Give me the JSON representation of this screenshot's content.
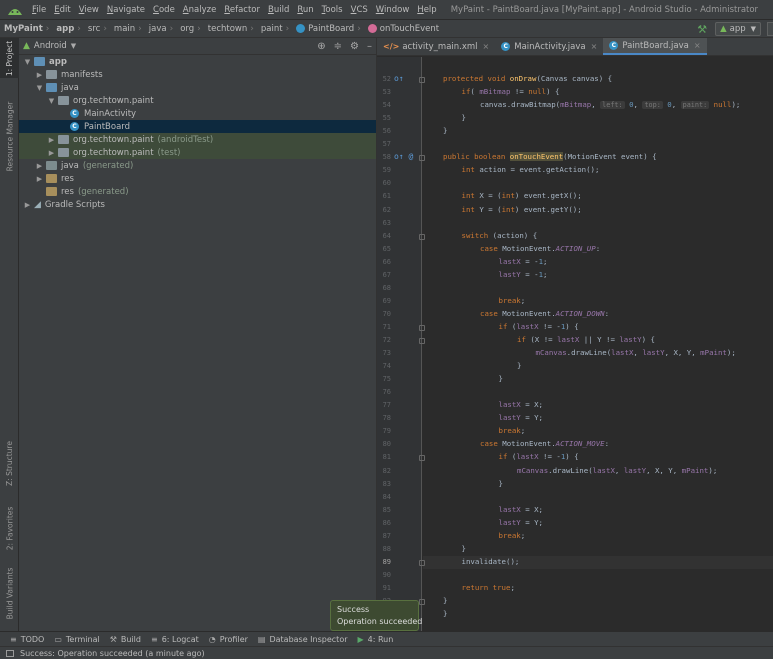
{
  "menubar": {
    "items": [
      "File",
      "Edit",
      "View",
      "Navigate",
      "Code",
      "Analyze",
      "Refactor",
      "Build",
      "Run",
      "Tools",
      "VCS",
      "Window",
      "Help"
    ],
    "window_title": "MyPaint - PaintBoard.java [MyPaint.app] - Android Studio - Administrator"
  },
  "navbar": {
    "crumbs": [
      "MyPaint",
      "app",
      "src",
      "main",
      "java",
      "org",
      "techtown",
      "paint",
      "PaintBoard",
      "onTouchEvent"
    ],
    "run_config": "app"
  },
  "left_strip": {
    "tabs": [
      "1: Project",
      "Resource Manager",
      "Z: Structure",
      "2: Favorites",
      "Build Variants"
    ]
  },
  "project": {
    "view_mode": "Android",
    "tree": [
      {
        "label": "app",
        "level": 0,
        "arrow": "open",
        "icon": "module"
      },
      {
        "label": "manifests",
        "level": 1,
        "arrow": "closed",
        "icon": "folder"
      },
      {
        "label": "java",
        "level": 1,
        "arrow": "open",
        "icon": "folder-blue"
      },
      {
        "label": "org.techtown.paint",
        "level": 2,
        "arrow": "open",
        "icon": "package"
      },
      {
        "label": "MainActivity",
        "level": 3,
        "arrow": "",
        "icon": "class"
      },
      {
        "label": "PaintBoard",
        "level": 3,
        "arrow": "",
        "icon": "class",
        "selected": true
      },
      {
        "label": "org.techtown.paint",
        "suffix": "(androidTest)",
        "level": 2,
        "arrow": "closed",
        "icon": "package",
        "tested": true
      },
      {
        "label": "org.techtown.paint",
        "suffix": "(test)",
        "level": 2,
        "arrow": "closed",
        "icon": "package",
        "tested": true
      },
      {
        "label": "java",
        "suffix": "(generated)",
        "level": 1,
        "arrow": "closed",
        "icon": "folder-gen"
      },
      {
        "label": "res",
        "level": 1,
        "arrow": "closed",
        "icon": "folder-res"
      },
      {
        "label": "res",
        "suffix": "(generated)",
        "level": 1,
        "arrow": "",
        "icon": "folder-res"
      },
      {
        "label": "Gradle Scripts",
        "level": 0,
        "arrow": "closed",
        "icon": "gradle"
      }
    ]
  },
  "editor": {
    "tabs": [
      {
        "label": "activity_main.xml",
        "icon": "xml",
        "active": false
      },
      {
        "label": "MainActivity.java",
        "icon": "class",
        "active": false
      },
      {
        "label": "PaintBoard.java",
        "icon": "class",
        "active": true
      }
    ],
    "lines": [
      {
        "n": "52",
        "html": "<span class=\"kw\">protected void </span><span class=\"fn\">onDraw</span>(Canvas canvas) {",
        "indent": 1,
        "mark": "override"
      },
      {
        "n": "53",
        "html": "<span class=\"kw\">if</span>( <span class=\"fld\">mBitmap</span> != <span class=\"kw\">null</span>) {",
        "indent": 2
      },
      {
        "n": "54",
        "html": "canvas.drawBitmap(<span class=\"fld\">mBitmap</span>, <span class=\"hint\">left:</span> <span class=\"num\">0</span>, <span class=\"hint\">top:</span> <span class=\"num\">0</span>, <span class=\"hint\">paint:</span> <span class=\"kw\">null</span>);",
        "indent": 3
      },
      {
        "n": "55",
        "html": "}",
        "indent": 2
      },
      {
        "n": "56",
        "html": "}",
        "indent": 1
      },
      {
        "n": "57",
        "html": "",
        "indent": 0
      },
      {
        "n": "58",
        "html": "<span class=\"kw\">public boolean </span><span class=\"fn hl\">onTouchEvent</span>(MotionEvent event) {",
        "indent": 1,
        "mark": "override-at"
      },
      {
        "n": "59",
        "html": "<span class=\"kw\">int </span>action = event.getAction();",
        "indent": 2
      },
      {
        "n": "60",
        "html": "",
        "indent": 0
      },
      {
        "n": "61",
        "html": "<span class=\"kw\">int </span>X = (<span class=\"kw\">int</span>) event.getX();",
        "indent": 2
      },
      {
        "n": "62",
        "html": "<span class=\"kw\">int </span>Y = (<span class=\"kw\">int</span>) event.getY();",
        "indent": 2
      },
      {
        "n": "63",
        "html": "",
        "indent": 0
      },
      {
        "n": "64",
        "html": "<span class=\"kw\">switch </span>(action) {",
        "indent": 2
      },
      {
        "n": "65",
        "html": "<span class=\"kw\">case </span>MotionEvent.<span class=\"st\">ACTION_UP</span>:",
        "indent": 3
      },
      {
        "n": "66",
        "html": "<span class=\"fld\">lastX</span> = -<span class=\"num\">1</span>;",
        "indent": 4
      },
      {
        "n": "67",
        "html": "<span class=\"fld\">lastY</span> = -<span class=\"num\">1</span>;",
        "indent": 4
      },
      {
        "n": "68",
        "html": "",
        "indent": 0
      },
      {
        "n": "69",
        "html": "<span class=\"kw\">break</span>;",
        "indent": 4
      },
      {
        "n": "70",
        "html": "<span class=\"kw\">case </span>MotionEvent.<span class=\"st\">ACTION_DOWN</span>:",
        "indent": 3
      },
      {
        "n": "71",
        "html": "<span class=\"kw\">if </span>(<span class=\"fld\">lastX</span> != -<span class=\"num\">1</span>) {",
        "indent": 4
      },
      {
        "n": "72",
        "html": "<span class=\"kw\">if </span>(X != <span class=\"fld\">lastX</span> || Y != <span class=\"fld\">lastY</span>) {",
        "indent": 5
      },
      {
        "n": "73",
        "html": "<span class=\"fld\">mCanvas</span>.drawLine(<span class=\"fld\">lastX</span>, <span class=\"fld\">lastY</span>, X, Y, <span class=\"fld\">mPaint</span>);",
        "indent": 6
      },
      {
        "n": "74",
        "html": "}",
        "indent": 5
      },
      {
        "n": "75",
        "html": "}",
        "indent": 4
      },
      {
        "n": "76",
        "html": "",
        "indent": 0
      },
      {
        "n": "77",
        "html": "<span class=\"fld\">lastX</span> = X;",
        "indent": 4
      },
      {
        "n": "78",
        "html": "<span class=\"fld\">lastY</span> = Y;",
        "indent": 4
      },
      {
        "n": "79",
        "html": "<span class=\"kw\">break</span>;",
        "indent": 4
      },
      {
        "n": "80",
        "html": "<span class=\"kw\">case </span>MotionEvent.<span class=\"st\">ACTION_MOVE</span>:",
        "indent": 3
      },
      {
        "n": "81",
        "html": "<span class=\"kw\">if </span>(<span class=\"fld\">lastX</span> != -<span class=\"num\">1</span>) {",
        "indent": 4
      },
      {
        "n": "82",
        "html": "<span class=\"fld\">mCanvas</span>.drawLine(<span class=\"fld\">lastX</span>, <span class=\"fld\">lastY</span>, X, Y, <span class=\"fld\">mPaint</span>);",
        "indent": 5
      },
      {
        "n": "83",
        "html": "}",
        "indent": 4
      },
      {
        "n": "84",
        "html": "",
        "indent": 0
      },
      {
        "n": "85",
        "html": "<span class=\"fld\">lastX</span> = X;",
        "indent": 4
      },
      {
        "n": "86",
        "html": "<span class=\"fld\">lastY</span> = Y;",
        "indent": 4
      },
      {
        "n": "87",
        "html": "<span class=\"kw\">break</span>;",
        "indent": 4
      },
      {
        "n": "88",
        "html": "}",
        "indent": 2
      },
      {
        "n": "89",
        "html": "invalidate();",
        "indent": 2,
        "caret": true
      },
      {
        "n": "90",
        "html": "",
        "indent": 0
      },
      {
        "n": "91",
        "html": "<span class=\"kw\">return true</span>;",
        "indent": 2
      },
      {
        "n": "92",
        "html": "}",
        "indent": 1
      },
      {
        "n": "93",
        "html": "}",
        "indent": 0
      }
    ]
  },
  "bottom_tools": [
    {
      "label": "TODO",
      "icon": "≡"
    },
    {
      "label": "Terminal",
      "icon": "▭"
    },
    {
      "label": "Build",
      "icon": "⚒"
    },
    {
      "label": "6: Logcat",
      "icon": "≡"
    },
    {
      "label": "Profiler",
      "icon": "◔"
    },
    {
      "label": "Database Inspector",
      "icon": "▤"
    },
    {
      "label": "4: Run",
      "icon": "▶"
    }
  ],
  "popup": {
    "title": "Success",
    "message": "Operation succeeded"
  },
  "status": {
    "text": "Success: Operation succeeded (a minute ago)"
  }
}
